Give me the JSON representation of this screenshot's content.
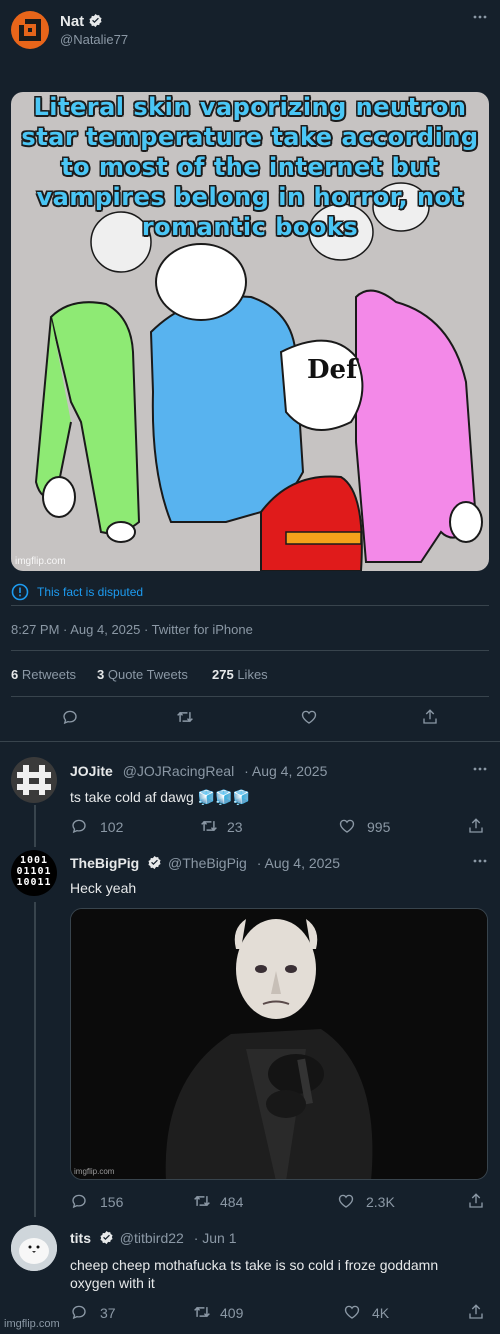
{
  "main_tweet": {
    "author_name": "Nat",
    "author_handle": "@Natalie77",
    "meme_text": "Literal skin vaporizing neutron star temperature take according to most of the internet but vampires belong in horror, not romantic books",
    "meme_def_text": "Def",
    "meme_watermark": "imgflip.com",
    "disputed_notice": "This fact is disputed",
    "timestamp": "8:27 PM · Aug 4, 2025 · Twitter for iPhone",
    "stats": {
      "retweets_count": "6",
      "retweets_label": "Retweets",
      "quotes_count": "3",
      "quotes_label": "Quote Tweets",
      "likes_count": "275",
      "likes_label": "Likes"
    }
  },
  "replies": [
    {
      "author_name": "JOJite",
      "author_handle": "@JOJRacingReal",
      "date": "· Aug 4, 2025",
      "text": "ts take cold af dawg 🧊🧊🧊",
      "replies": "102",
      "retweets": "23",
      "likes": "995"
    },
    {
      "author_name": "TheBigPig",
      "author_handle": "@TheBigPig",
      "date": "· Aug 4, 2025",
      "text": "Heck yeah",
      "image_watermark": "imgflip.com",
      "replies": "156",
      "retweets": "484",
      "likes": "2.3K"
    },
    {
      "author_name": "tits",
      "author_handle": "@titbird22",
      "date": "· Jun 1",
      "text": "cheep cheep mothafucka ts take is so cold i froze goddamn oxygen with it",
      "replies": "37",
      "retweets": "409",
      "likes": "4K"
    }
  ],
  "footer_watermark": "imgflip.com",
  "colors": {
    "background": "#15202b",
    "accent_blue": "#1d9bf0",
    "meme_text_blue": "#4ac6f5",
    "divider": "#38444d",
    "muted": "#8b98a5"
  }
}
